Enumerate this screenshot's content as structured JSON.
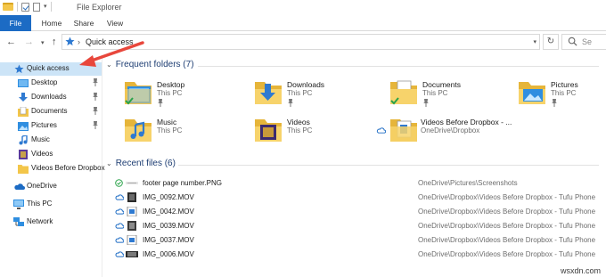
{
  "window": {
    "title": "File Explorer"
  },
  "ribbon": {
    "tabs": [
      "File",
      "Home",
      "Share",
      "View"
    ]
  },
  "address": {
    "path": "Quick access"
  },
  "sidebar": {
    "items": [
      {
        "label": "Quick access",
        "icon": "quick-access-star-icon"
      },
      {
        "label": "Desktop",
        "icon": "desktop-folder-icon",
        "pinned": true
      },
      {
        "label": "Downloads",
        "icon": "downloads-folder-icon",
        "pinned": true
      },
      {
        "label": "Documents",
        "icon": "documents-folder-icon",
        "pinned": true
      },
      {
        "label": "Pictures",
        "icon": "pictures-folder-icon",
        "pinned": true
      },
      {
        "label": "Music",
        "icon": "music-icon"
      },
      {
        "label": "Videos",
        "icon": "videos-folder-icon"
      },
      {
        "label": "Videos Before Dropbox",
        "icon": "folder-icon"
      },
      {
        "label": "OneDrive",
        "icon": "onedrive-cloud-icon"
      },
      {
        "label": "This PC",
        "icon": "this-pc-icon"
      },
      {
        "label": "Network",
        "icon": "network-icon"
      }
    ]
  },
  "frequent": {
    "header": "Frequent folders (7)",
    "folders": [
      {
        "name": "Desktop",
        "location": "This PC"
      },
      {
        "name": "Downloads",
        "location": "This PC"
      },
      {
        "name": "Documents",
        "location": "This PC"
      },
      {
        "name": "Pictures",
        "location": "This PC"
      },
      {
        "name": "Music",
        "location": "This PC"
      },
      {
        "name": "Videos",
        "location": "This PC"
      },
      {
        "name": "Videos Before Dropbox - ...",
        "location": "OneDrive\\Dropbox"
      }
    ]
  },
  "recent": {
    "header": "Recent files (6)",
    "files": [
      {
        "name": "footer page number.PNG",
        "location": "OneDrive\\Pictures\\Screenshots"
      },
      {
        "name": "IMG_0092.MOV",
        "location": "OneDrive\\Dropbox\\Videos Before Dropbox - Tufu Phone"
      },
      {
        "name": "IMG_0042.MOV",
        "location": "OneDrive\\Dropbox\\Videos Before Dropbox - Tufu Phone"
      },
      {
        "name": "IMG_0039.MOV",
        "location": "OneDrive\\Dropbox\\Videos Before Dropbox - Tufu Phone"
      },
      {
        "name": "IMG_0037.MOV",
        "location": "OneDrive\\Dropbox\\Videos Before Dropbox - Tufu Phone"
      },
      {
        "name": "IMG_0006.MOV",
        "location": "OneDrive\\Dropbox\\Videos Before Dropbox - Tufu Phone"
      }
    ]
  },
  "search": {
    "placeholder": "Se"
  },
  "watermark": "wsxdn.com",
  "colors": {
    "accent": "#1c6bc4",
    "selection": "#cce4f7",
    "folder": "#f3c64a",
    "arrow": "#e8473c",
    "header_text": "#1e3e73"
  }
}
